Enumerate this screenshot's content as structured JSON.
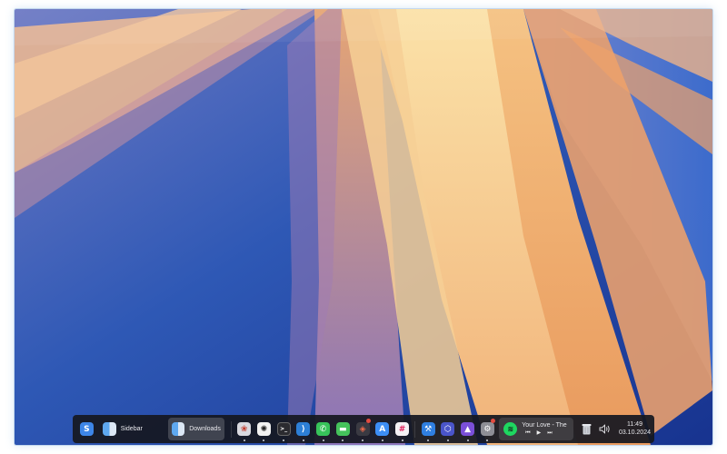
{
  "taskbar": {
    "start_icon": "s-logo-icon",
    "windows": [
      {
        "label": "Sidebar",
        "icon": "finder-icon",
        "active": false
      },
      {
        "label": "Downloads",
        "icon": "finder-icon",
        "active": true
      }
    ],
    "apps": [
      {
        "name": "photos-icon",
        "color": "#d9d9e0"
      },
      {
        "name": "chatgpt-icon",
        "color": "#f2f2f2"
      },
      {
        "name": "terminal-icon",
        "color": "#2b2b30"
      },
      {
        "name": "vscode-icon",
        "color": "#2d7fd6"
      },
      {
        "name": "whatsapp-icon",
        "color": "#37c35a"
      },
      {
        "name": "messages-icon",
        "color": "#45c25b"
      },
      {
        "name": "figma-icon",
        "color": "#3a3a42"
      },
      {
        "name": "appstore-icon",
        "color": "#3d8ef5"
      },
      {
        "name": "slack-icon",
        "color": "#f5f1f5"
      },
      {
        "name": "xcode-icon",
        "color": "#2f7fe0"
      },
      {
        "name": "cube-app-icon",
        "color": "#4a55c9"
      },
      {
        "name": "affinity-icon",
        "color": "#7a4fd8"
      },
      {
        "name": "settings-icon",
        "color": "#8e8e95"
      }
    ],
    "media": {
      "title": "Your Love - The",
      "app_icon": "spotify-icon",
      "prev": "⏮",
      "play": "▶",
      "next": "⏭"
    },
    "trash_icon": "trash-icon",
    "volume_icon": "volume-icon",
    "time": "11:49",
    "date": "03.10.2024",
    "colors": {
      "taskbar": "#16182099",
      "accent_spotify": "#1ed760"
    }
  }
}
